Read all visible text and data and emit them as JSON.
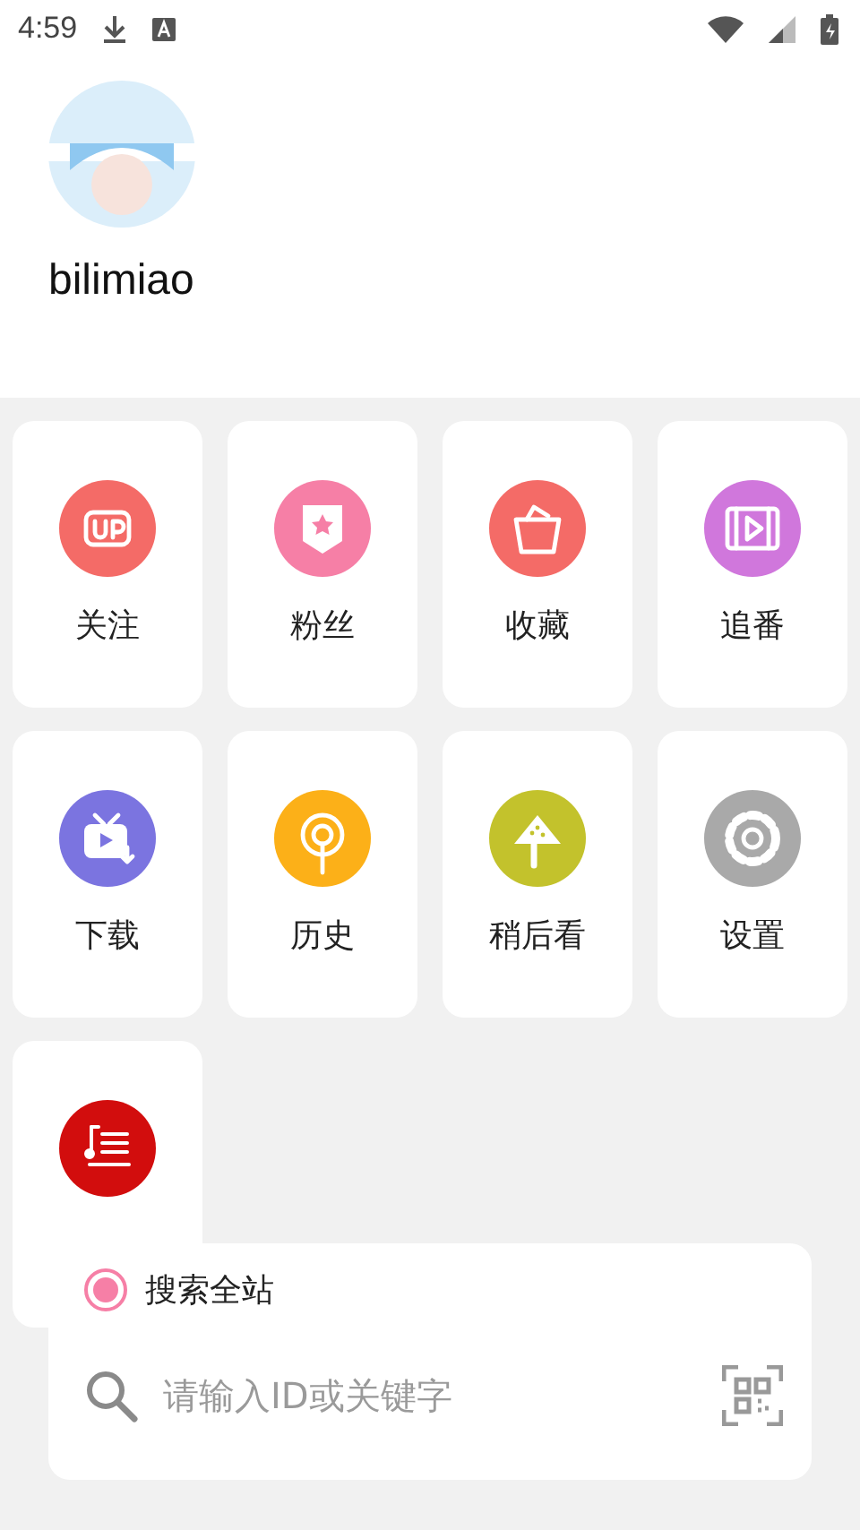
{
  "status_bar": {
    "time": "4:59"
  },
  "profile": {
    "name": "bilimiao"
  },
  "menu": [
    {
      "label": "关注",
      "kind": "up",
      "color": "#f46b67"
    },
    {
      "label": "粉丝",
      "kind": "badge",
      "color": "#f67fa6"
    },
    {
      "label": "收藏",
      "kind": "bucket",
      "color": "#f46b67"
    },
    {
      "label": "追番",
      "kind": "film",
      "color": "#d077dc"
    },
    {
      "label": "下载",
      "kind": "tv",
      "color": "#7b74e0"
    },
    {
      "label": "历史",
      "kind": "radio",
      "color": "#fcb018"
    },
    {
      "label": "稍后看",
      "kind": "melon",
      "color": "#c3c22c"
    },
    {
      "label": "设置",
      "kind": "gear",
      "color": "#a9a9a9"
    },
    {
      "kind": "lyrics",
      "color": "#d20d0d"
    }
  ],
  "search": {
    "scope": {
      "label": "搜索全站",
      "selected": true
    },
    "placeholder": "请输入ID或关键字"
  }
}
